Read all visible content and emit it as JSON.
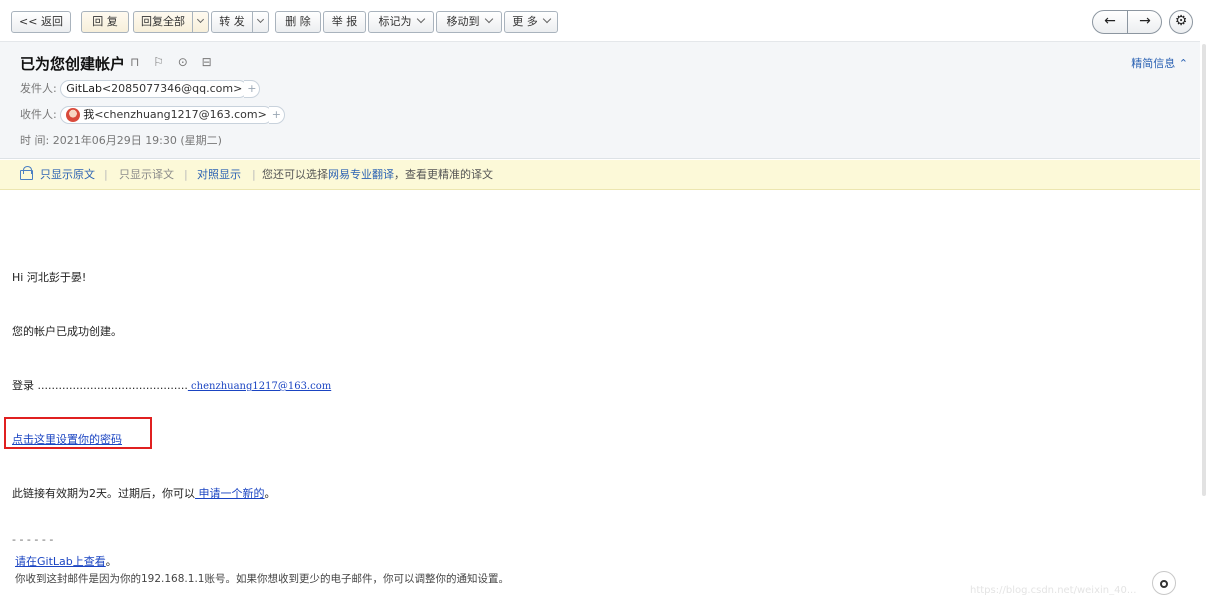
{
  "toolbar": {
    "back": "<< 返回",
    "reply": "回 复",
    "reply_all": "回复全部",
    "forward": "转 发",
    "delete": "删 除",
    "report": "举 报",
    "mark_as": "标记为",
    "move_to": "移动到",
    "more": "更 多",
    "prev_icon": "←",
    "next_icon": "→",
    "settings_icon": "⚙"
  },
  "header": {
    "subject": "已为您创建帐户",
    "subject_icons": "⊓ ⚐ ⊙ ⊟",
    "brief_link": "精简信息 ⌃",
    "from_label": "发件人:",
    "from_name": "GitLab",
    "from_email": "<2085077346@qq.com>",
    "to_label": "收件人:",
    "to_name": "我",
    "to_email": "<chenzhuang1217@163.com>",
    "plus": "+",
    "time_label": "时  间:",
    "time_value": "2021年06月29日 19:30 (星期二)"
  },
  "translate": {
    "original_only": "只显示原文",
    "translation_only": "只显示译文",
    "side_by_side": "对照显示",
    "hint_prefix": "您还可以选择",
    "pro_translate": "网易专业翻译",
    "hint_suffix": "，查看更精准的译文",
    "pipe": "|"
  },
  "body": {
    "greeting": "Hi 河北彭于晏!",
    "created": "您的帐户已成功创建。",
    "login_label": "登录 ...........................................",
    "login_email": "  chenzhuang1217@163.com",
    "set_password_link": "点击这里设置你的密码",
    "expiry_prefix": "此链接有效期为2天。过期后，你可以",
    "expiry_link": " 申请一个新的",
    "expiry_suffix": "。",
    "divider": "- - - - - -",
    "view_on_gitlab": "请在GitLab上查看",
    "view_suffix": "。",
    "footer_note": "你收到这封邮件是因为你的192.168.1.1账号。如果你想收到更少的电子邮件，你可以调整你的通知设置。",
    "watermark": "https://blog.csdn.net/weixin_40..."
  }
}
